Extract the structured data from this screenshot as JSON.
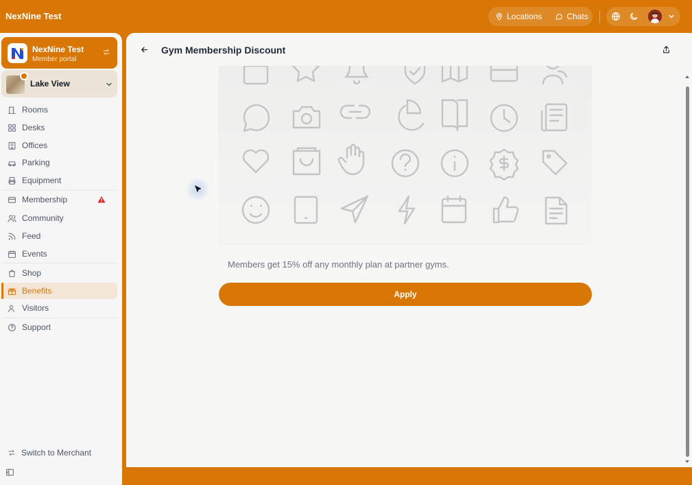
{
  "app": {
    "title": "NexNine Test"
  },
  "topnav": {
    "locations_label": "Locations",
    "chats_label": "Chats"
  },
  "account": {
    "name": "NexNine Test",
    "subtitle": "Member portal"
  },
  "location": {
    "name": "Lake View"
  },
  "sidebar": {
    "items": [
      {
        "label": "Rooms",
        "icon": "door-icon"
      },
      {
        "label": "Desks",
        "icon": "grid-icon"
      },
      {
        "label": "Offices",
        "icon": "building-icon"
      },
      {
        "label": "Parking",
        "icon": "car-icon"
      },
      {
        "label": "Equipment",
        "icon": "printer-icon"
      },
      {
        "label": "Membership",
        "icon": "card-icon",
        "badge": "warning-icon"
      },
      {
        "label": "Community",
        "icon": "users-icon"
      },
      {
        "label": "Feed",
        "icon": "rss-icon"
      },
      {
        "label": "Events",
        "icon": "calendar-icon"
      },
      {
        "label": "Shop",
        "icon": "bag-icon"
      },
      {
        "label": "Benefits",
        "icon": "gift-icon",
        "active": true
      },
      {
        "label": "Visitors",
        "icon": "user-icon"
      },
      {
        "label": "Support",
        "icon": "help-icon"
      }
    ],
    "switch_merchant": "Switch to Merchant"
  },
  "page": {
    "title": "Gym Membership Discount",
    "description": "Members get 15% off any monthly plan at partner gyms.",
    "apply_label": "Apply"
  },
  "colors": {
    "accent": "#D97706",
    "warning": "#DC2626"
  }
}
